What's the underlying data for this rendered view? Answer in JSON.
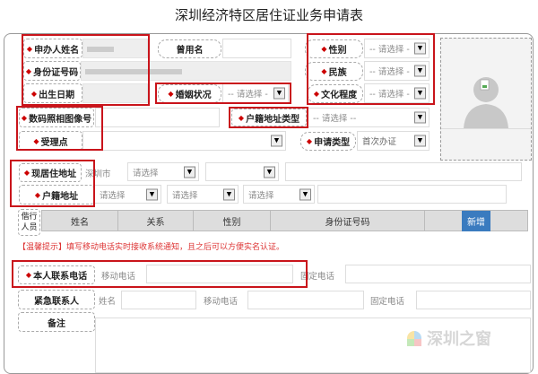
{
  "title": "深圳经济特区居住证业务申请表",
  "labels": {
    "name": "申办人姓名",
    "alias": "曾用名",
    "gender": "性别",
    "id": "身份证号码",
    "ethnic": "民族",
    "birth": "出生日期",
    "marital": "婚姻状况",
    "education": "文化程度",
    "photo_no": "数码照相图像号",
    "hukou_type": "户籍地址类型",
    "office": "受理点",
    "apply_type": "申请类型",
    "residence": "现居住地址",
    "hukou": "户籍地址",
    "companions": "偕行人员",
    "phone": "本人联系电话",
    "emergency": "紧急联系人",
    "remark": "备注"
  },
  "select": {
    "please": "-- 请选择 -",
    "please2": "-- 请选择 --",
    "plain": "请选择",
    "apply_type_value": "首次办证",
    "city": "深圳市"
  },
  "table": {
    "headers": [
      "姓名",
      "关系",
      "性别",
      "身份证号码"
    ],
    "add": "新增"
  },
  "tip": "【温馨提示】填写移动电话实时接收系统通知，且之后可以方便实名认证。",
  "phone": {
    "mobile": "移动电话",
    "fixed": "固定电话",
    "name": "姓名"
  },
  "watermark": "深圳之窗",
  "colors": {
    "accent": "#c9141b",
    "button": "#3a7bbf"
  }
}
